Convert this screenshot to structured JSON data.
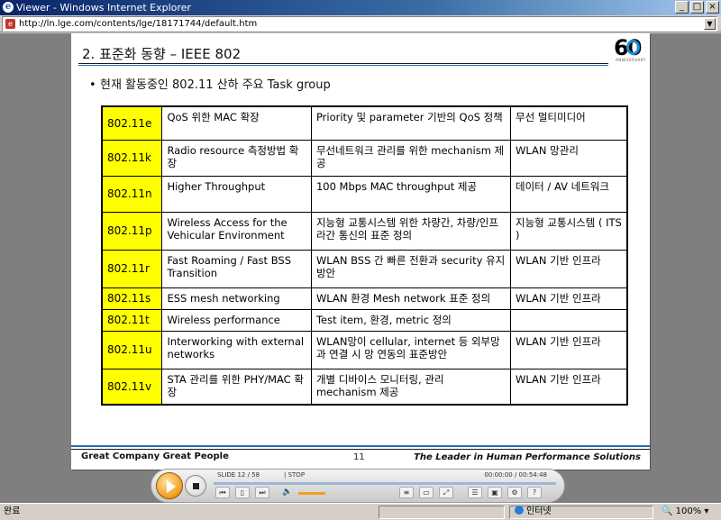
{
  "window": {
    "title": "Viewer - Windows Internet Explorer",
    "buttons": [
      "_",
      "□",
      "×"
    ]
  },
  "address": {
    "url": "http://ln.lge.com/contents/lge/18171744/default.htm"
  },
  "slide": {
    "title": "2. 표준화 동향 – IEEE 802",
    "bullet": "현재 활동중인 802.11 산하 주요 Task group",
    "logo_number": "60",
    "logo_sub": "ANNIVERSARY",
    "rows": [
      {
        "code": "802.11e",
        "name": "QoS 위한 MAC 확장",
        "desc": "Priority 및 parameter 기반의 QoS 정책",
        "app": "무선 멀티미디어"
      },
      {
        "code": "802.11k",
        "name": "Radio resource 측정방법 확장",
        "desc": "무선네트워크 관리를 위한 mechanism 제공",
        "app": "WLAN 망관리"
      },
      {
        "code": "802.11n",
        "name": "Higher Throughput",
        "desc": "100 Mbps MAC throughput 제공",
        "app": "데이터 / AV 네트워크"
      },
      {
        "code": "802.11p",
        "name": "Wireless Access for the Vehicular Environment",
        "desc": "지능형 교통시스템 위한 차량간, 차량/인프라간 통신의 표준 정의",
        "app": "지능형 교통시스템 ( ITS )"
      },
      {
        "code": "802.11r",
        "name": "Fast Roaming / Fast BSS Transition",
        "desc": "WLAN BSS 간 빠른 전환과 security 유지 방안",
        "app": "WLAN 기반 인프라"
      },
      {
        "code": "802.11s",
        "name": "ESS mesh networking",
        "desc": "WLAN 환경 Mesh network 표준 정의",
        "app": "WLAN 기반 인프라"
      },
      {
        "code": "802.11t",
        "name": "Wireless performance",
        "desc": "Test item, 환경, metric 정의",
        "app": ""
      },
      {
        "code": "802.11u",
        "name": "Interworking with external networks",
        "desc": "WLAN망이 cellular, internet 등 외부망과 연결 시 망 연동의 표준방안",
        "app": "WLAN 기반 인프라"
      },
      {
        "code": "802.11v",
        "name": "STA 관리를 위한 PHY/MAC 확장",
        "desc": "개별 디바이스 모니터링, 관리 mechanism 제공",
        "app": "WLAN 기반 인프라"
      }
    ],
    "footer": {
      "left": "Great Company   Great People",
      "page": "11",
      "right": "The Leader in Human Performance Solutions"
    }
  },
  "player": {
    "slide_info": "SLIDE  12 / 58",
    "state": "|  STOP",
    "time": "00:00:00 / 00:54:48"
  },
  "statusbar": {
    "status": "완료",
    "zone": "인터넷",
    "zoom": "100%"
  },
  "colors": {
    "code_highlight": "#ffff00",
    "accent_blue": "#2a6eb5"
  }
}
